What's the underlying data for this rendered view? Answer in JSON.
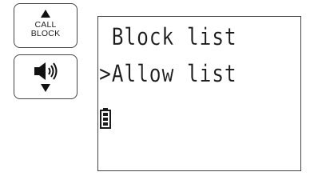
{
  "handset": {
    "call_block_button": {
      "label_line1": "CALL",
      "label_line2": "BLOCK",
      "icon": "up-arrow-icon"
    },
    "volume_button": {
      "icon": "speaker-icon",
      "arrow_icon": "down-arrow-icon"
    }
  },
  "lcd": {
    "line1": " Block list",
    "line2_cursor": ">",
    "line2_text": "Allow list",
    "status_icon": "battery-icon",
    "colors": {
      "text": "#1a1a1a",
      "border": "#444444",
      "background": "#ffffff"
    }
  }
}
